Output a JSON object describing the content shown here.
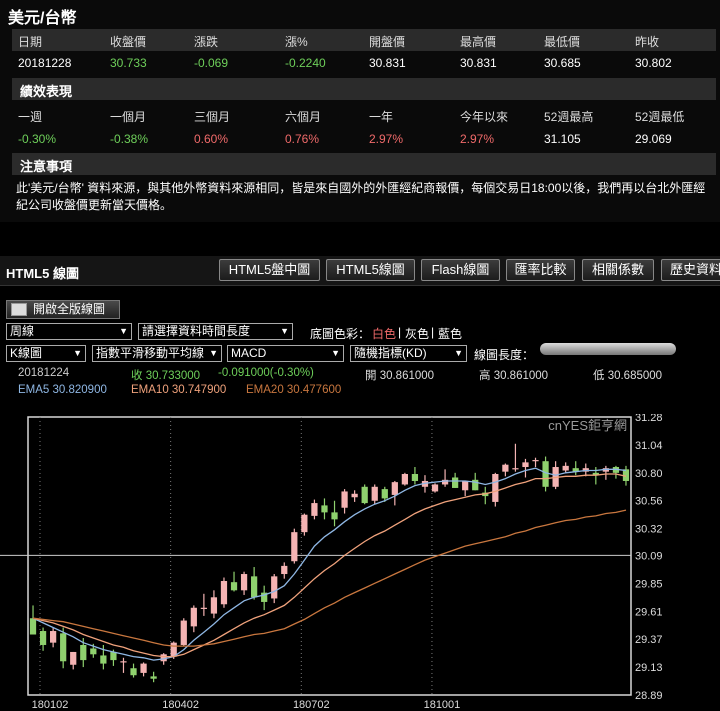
{
  "header": {
    "title": "美元/台幣"
  },
  "quote": {
    "headers": [
      "日期",
      "收盤價",
      "漲跌",
      "漲%",
      "開盤價",
      "最高價",
      "最低價",
      "昨收"
    ],
    "values": [
      "20181228",
      "30.733",
      "-0.069",
      "-0.2240",
      "30.831",
      "30.831",
      "30.685",
      "30.802"
    ]
  },
  "performance": {
    "title": "績效表現",
    "headers": [
      "一週",
      "一個月",
      "三個月",
      "六個月",
      "一年",
      "今年以來",
      "52週最高",
      "52週最低"
    ],
    "values": [
      "-0.30%",
      "-0.38%",
      "0.60%",
      "0.76%",
      "2.97%",
      "2.97%",
      "31.105",
      "29.069"
    ]
  },
  "notice": {
    "title": "注意事項",
    "text": "此'美元/台幣' 資料來源，與其他外幣資料來源相同，皆是來自國外的外匯經紀商報價，每個交易日18:00以後，我們再以台北外匯經紀公司收盤價更新當天價格。"
  },
  "html5": {
    "title": "HTML5 線圖",
    "tabs": [
      "HTML5盤中圖",
      "HTML5線圖",
      "Flash線圖",
      "匯率比較",
      "相關係數",
      "歷史資料"
    ]
  },
  "controls": {
    "full_button": "開啟全版線圖",
    "period": "周線",
    "range": "請選擇資料時間長度",
    "bg_label": "底圖色彩：",
    "bg_white": "白色",
    "bg_sep1": "|",
    "bg_gray": "灰色",
    "bg_sep2": "|",
    "bg_blue": "藍色",
    "chart_type": "K線圖",
    "ma_type": "指數平滑移動平均線",
    "indicator1": "MACD",
    "indicator2": "隨機指標(KD)",
    "length_label": "線圖長度："
  },
  "info": {
    "date": "20181224",
    "close": "收 30.733000",
    "change": "-0.091000(-0.30%)",
    "open": "開 30.861000",
    "high": "高 30.861000",
    "low": "低 30.685000",
    "ema5": "EMA5 30.820900",
    "ema10": "EMA10 30.747900",
    "ema20": "EMA20 30.477600"
  },
  "colors": {
    "up": "#f4b3b3",
    "down": "#8fd16e",
    "ema5": "#8fb7e4",
    "ema10": "#f0a27c",
    "ema20": "#c9773f",
    "frame": "#d8d8d8",
    "refline": "#cccccc"
  },
  "chart_data": {
    "type": "candlestick",
    "watermark": "cnYES鉅亨網",
    "ylim": [
      28.89,
      31.28
    ],
    "yticks": [
      "31.28",
      "31.04",
      "30.80",
      "30.56",
      "30.32",
      "30.09",
      "29.85",
      "29.61",
      "29.37",
      "29.13",
      "28.89"
    ],
    "ref_line": 30.09,
    "xlabels": [
      {
        "index": 0,
        "label": "180102"
      },
      {
        "index": 13,
        "label": "180402"
      },
      {
        "index": 26,
        "label": "180702"
      },
      {
        "index": 39,
        "label": "181001"
      }
    ],
    "candles": [
      [
        29.55,
        29.66,
        29.41,
        29.41
      ],
      [
        29.44,
        29.47,
        29.27,
        29.32
      ],
      [
        29.34,
        29.47,
        29.3,
        29.44
      ],
      [
        29.42,
        29.47,
        29.12,
        29.18
      ],
      [
        29.15,
        29.26,
        29.11,
        29.26
      ],
      [
        29.32,
        29.38,
        29.13,
        29.19
      ],
      [
        29.29,
        29.33,
        29.21,
        29.24
      ],
      [
        29.23,
        29.32,
        29.11,
        29.16
      ],
      [
        29.26,
        29.28,
        29.14,
        29.19
      ],
      [
        29.17,
        29.21,
        29.08,
        29.18
      ],
      [
        29.12,
        29.16,
        29.04,
        29.06
      ],
      [
        29.08,
        29.17,
        29.05,
        29.16
      ],
      [
        29.05,
        29.09,
        29.0,
        29.03
      ],
      [
        29.18,
        29.25,
        29.15,
        29.24
      ],
      [
        29.22,
        29.35,
        29.2,
        29.34
      ],
      [
        29.32,
        29.55,
        29.31,
        29.53
      ],
      [
        29.48,
        29.66,
        29.43,
        29.64
      ],
      [
        29.63,
        29.76,
        29.57,
        29.64
      ],
      [
        29.59,
        29.79,
        29.55,
        29.73
      ],
      [
        29.67,
        29.9,
        29.64,
        29.87
      ],
      [
        29.86,
        29.95,
        29.78,
        29.79
      ],
      [
        29.79,
        29.95,
        29.75,
        29.93
      ],
      [
        29.91,
        29.99,
        29.71,
        29.73
      ],
      [
        29.77,
        29.83,
        29.62,
        29.69
      ],
      [
        29.72,
        29.93,
        29.68,
        29.91
      ],
      [
        29.93,
        30.03,
        29.89,
        30.0
      ],
      [
        30.04,
        30.32,
        30.02,
        30.29
      ],
      [
        30.29,
        30.45,
        30.26,
        30.44
      ],
      [
        30.43,
        30.57,
        30.4,
        30.54
      ],
      [
        30.52,
        30.58,
        30.4,
        30.46
      ],
      [
        30.46,
        30.56,
        30.34,
        30.4
      ],
      [
        30.5,
        30.66,
        30.45,
        30.64
      ],
      [
        30.59,
        30.65,
        30.55,
        30.62
      ],
      [
        30.68,
        30.7,
        30.53,
        30.54
      ],
      [
        30.56,
        30.7,
        30.53,
        30.68
      ],
      [
        30.66,
        30.68,
        30.55,
        30.58
      ],
      [
        30.61,
        30.73,
        30.52,
        30.72
      ],
      [
        30.7,
        30.8,
        30.69,
        30.79
      ],
      [
        30.79,
        30.85,
        30.7,
        30.73
      ],
      [
        30.68,
        30.78,
        30.63,
        30.73
      ],
      [
        30.64,
        30.71,
        30.63,
        30.7
      ],
      [
        30.7,
        30.83,
        30.68,
        30.74
      ],
      [
        30.76,
        30.8,
        30.67,
        30.67
      ],
      [
        30.65,
        30.73,
        30.6,
        30.73
      ],
      [
        30.74,
        30.8,
        30.65,
        30.65
      ],
      [
        30.63,
        30.68,
        30.53,
        30.6
      ],
      [
        30.55,
        30.8,
        30.51,
        30.79
      ],
      [
        30.81,
        30.88,
        30.77,
        30.87
      ],
      [
        30.83,
        31.05,
        30.81,
        30.84
      ],
      [
        30.85,
        30.92,
        30.76,
        30.89
      ],
      [
        30.91,
        30.93,
        30.85,
        30.91
      ],
      [
        30.9,
        30.94,
        30.64,
        30.68
      ],
      [
        30.68,
        30.9,
        30.66,
        30.85
      ],
      [
        30.82,
        30.89,
        30.8,
        30.86
      ],
      [
        30.84,
        30.9,
        30.78,
        30.81
      ],
      [
        30.81,
        30.88,
        30.77,
        30.84
      ],
      [
        30.8,
        30.85,
        30.7,
        30.78
      ],
      [
        30.81,
        30.86,
        30.74,
        30.84
      ],
      [
        30.85,
        30.86,
        30.75,
        30.8
      ],
      [
        30.83,
        30.86,
        30.69,
        30.73
      ]
    ],
    "series": [
      {
        "name": "EMA5",
        "values": [
          29.55,
          29.51,
          29.47,
          29.43,
          29.39,
          29.34,
          29.31,
          29.28,
          29.26,
          29.24,
          29.22,
          29.21,
          29.19,
          29.2,
          29.22,
          29.28,
          29.36,
          29.43,
          29.5,
          29.58,
          29.64,
          29.7,
          29.73,
          29.75,
          29.78,
          29.83,
          29.93,
          30.05,
          30.17,
          30.25,
          30.31,
          30.38,
          30.44,
          30.49,
          30.53,
          30.56,
          30.6,
          30.65,
          30.69,
          30.71,
          30.72,
          30.73,
          30.73,
          30.73,
          30.72,
          30.7,
          30.72,
          30.75,
          30.79,
          30.82,
          30.84,
          30.8,
          30.78,
          30.8,
          30.81,
          30.82,
          30.82,
          30.83,
          30.83,
          30.82
        ]
      },
      {
        "name": "EMA10",
        "values": [
          29.55,
          29.53,
          29.51,
          29.48,
          29.45,
          29.41,
          29.38,
          29.35,
          29.32,
          29.3,
          29.27,
          29.25,
          29.23,
          29.22,
          29.22,
          29.24,
          29.28,
          29.32,
          29.36,
          29.41,
          29.46,
          29.51,
          29.55,
          29.58,
          29.62,
          29.66,
          29.73,
          29.81,
          29.89,
          29.96,
          30.02,
          30.09,
          30.15,
          30.21,
          30.26,
          30.3,
          30.35,
          30.4,
          30.45,
          30.49,
          30.52,
          30.55,
          30.57,
          30.59,
          30.61,
          30.62,
          30.64,
          30.67,
          30.7,
          30.72,
          30.75,
          30.75,
          30.76,
          30.77,
          30.77,
          30.78,
          30.78,
          30.79,
          30.79,
          30.77
        ]
      },
      {
        "name": "EMA20",
        "values": [
          29.55,
          29.54,
          29.53,
          29.52,
          29.5,
          29.48,
          29.46,
          29.44,
          29.42,
          29.4,
          29.38,
          29.36,
          29.34,
          29.32,
          29.31,
          29.31,
          29.31,
          29.32,
          29.33,
          29.35,
          29.37,
          29.39,
          29.41,
          29.42,
          29.44,
          29.46,
          29.5,
          29.54,
          29.59,
          29.64,
          29.68,
          29.73,
          29.77,
          29.81,
          29.85,
          29.89,
          29.93,
          29.97,
          30.01,
          30.05,
          30.08,
          30.11,
          30.14,
          30.17,
          30.19,
          30.21,
          30.23,
          30.25,
          30.28,
          30.3,
          30.33,
          30.35,
          30.37,
          30.39,
          30.4,
          30.42,
          30.43,
          30.45,
          30.46,
          30.48
        ]
      }
    ]
  }
}
